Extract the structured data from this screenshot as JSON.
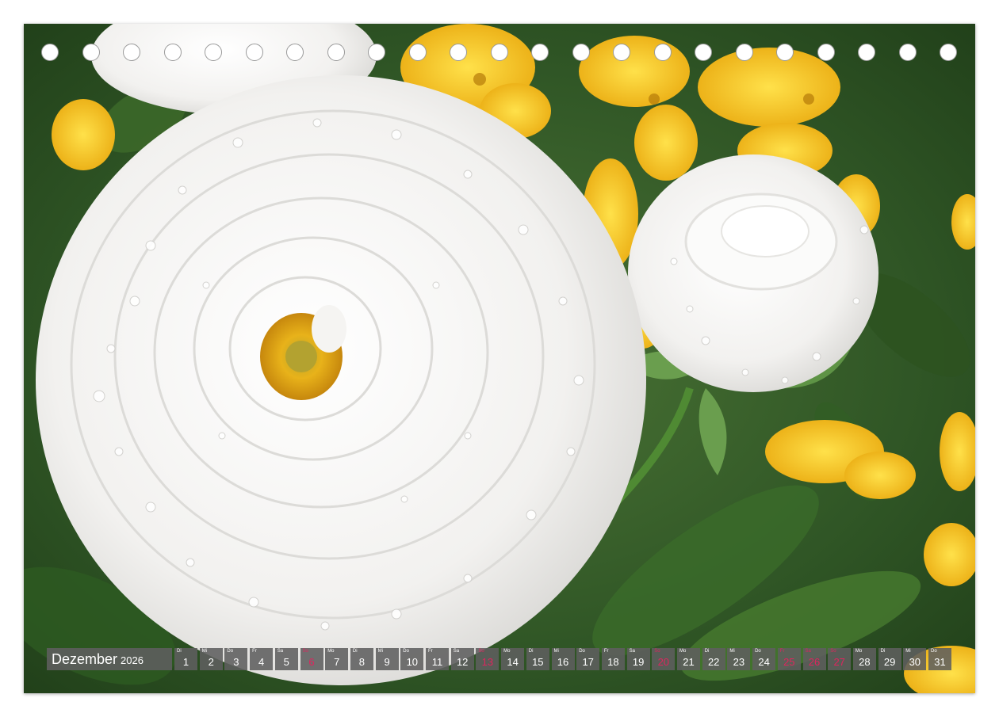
{
  "calendar": {
    "month": "Dezember",
    "year": "2026",
    "highlight_color": "#e0245e",
    "days": [
      {
        "wd": "Di",
        "d": "1",
        "red": false
      },
      {
        "wd": "Mi",
        "d": "2",
        "red": false
      },
      {
        "wd": "Do",
        "d": "3",
        "red": false
      },
      {
        "wd": "Fr",
        "d": "4",
        "red": false
      },
      {
        "wd": "Sa",
        "d": "5",
        "red": false
      },
      {
        "wd": "So",
        "d": "6",
        "red": true
      },
      {
        "wd": "Mo",
        "d": "7",
        "red": false
      },
      {
        "wd": "Di",
        "d": "8",
        "red": false
      },
      {
        "wd": "Mi",
        "d": "9",
        "red": false
      },
      {
        "wd": "Do",
        "d": "10",
        "red": false
      },
      {
        "wd": "Fr",
        "d": "11",
        "red": false
      },
      {
        "wd": "Sa",
        "d": "12",
        "red": false
      },
      {
        "wd": "So",
        "d": "13",
        "red": true
      },
      {
        "wd": "Mo",
        "d": "14",
        "red": false
      },
      {
        "wd": "Di",
        "d": "15",
        "red": false
      },
      {
        "wd": "Mi",
        "d": "16",
        "red": false
      },
      {
        "wd": "Do",
        "d": "17",
        "red": false
      },
      {
        "wd": "Fr",
        "d": "18",
        "red": false
      },
      {
        "wd": "Sa",
        "d": "19",
        "red": false
      },
      {
        "wd": "So",
        "d": "20",
        "red": true
      },
      {
        "wd": "Mo",
        "d": "21",
        "red": false
      },
      {
        "wd": "Di",
        "d": "22",
        "red": false
      },
      {
        "wd": "Mi",
        "d": "23",
        "red": false
      },
      {
        "wd": "Do",
        "d": "24",
        "red": false
      },
      {
        "wd": "Fr",
        "d": "25",
        "red": true
      },
      {
        "wd": "Sa",
        "d": "26",
        "red": true
      },
      {
        "wd": "So",
        "d": "27",
        "red": true
      },
      {
        "wd": "Mo",
        "d": "28",
        "red": false
      },
      {
        "wd": "Di",
        "d": "29",
        "red": false
      },
      {
        "wd": "Mi",
        "d": "30",
        "red": false
      },
      {
        "wd": "Do",
        "d": "31",
        "red": false
      }
    ]
  },
  "photo": {
    "subject": "white-ranunculus-with-dew",
    "colors": {
      "petal": "#f4f3f1",
      "center": "#e3a91a",
      "leaves": "#3f6b2c",
      "pansies": "#f3c418"
    }
  }
}
